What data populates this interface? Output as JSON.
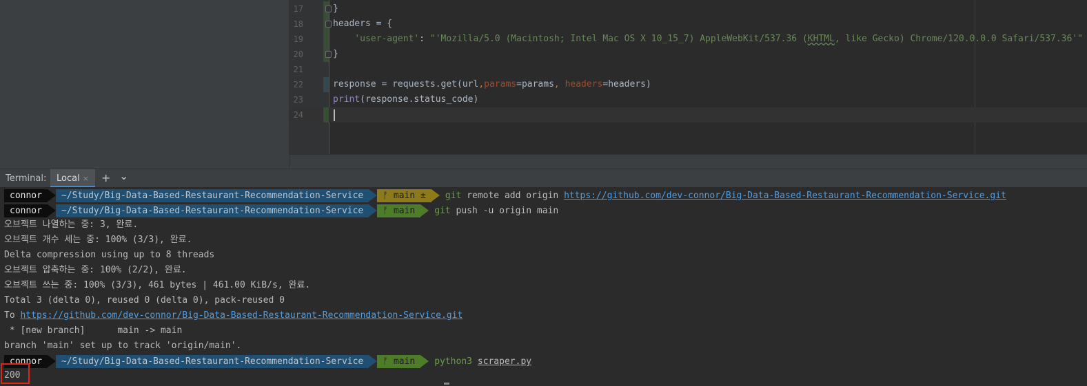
{
  "editor": {
    "lines": [
      {
        "num": "17",
        "tokens": [
          {
            "t": "}",
            "c": "plain"
          }
        ],
        "fold": true
      },
      {
        "num": "18",
        "tokens": [
          {
            "t": "headers = {",
            "c": "plain"
          }
        ],
        "fold": true
      },
      {
        "num": "19",
        "tokens": [
          {
            "t": "    ",
            "c": "plain"
          },
          {
            "t": "'user-agent'",
            "c": "str"
          },
          {
            "t": ": ",
            "c": "plain"
          },
          {
            "t": "\"'Mozilla/5.0 (Macintosh; Intel Mac OS X 10_15_7) AppleWebKit/537.36 (",
            "c": "str"
          },
          {
            "t": "KHTML",
            "c": "str-squiggle"
          },
          {
            "t": ", like Gecko) Chrome/120.0.0.0 Safari/537.36'\"",
            "c": "str"
          }
        ]
      },
      {
        "num": "20",
        "tokens": [
          {
            "t": "}",
            "c": "plain"
          }
        ],
        "fold": true
      },
      {
        "num": "21",
        "tokens": []
      },
      {
        "num": "22",
        "tokens": [
          {
            "t": "response = requests.get(url",
            "c": "plain"
          },
          {
            "t": ",",
            "c": "op"
          },
          {
            "t": "params",
            "c": "kwarg"
          },
          {
            "t": "=params",
            "c": "plain"
          },
          {
            "t": ", ",
            "c": "op"
          },
          {
            "t": "headers",
            "c": "kwarg"
          },
          {
            "t": "=headers)",
            "c": "plain"
          }
        ]
      },
      {
        "num": "23",
        "tokens": [
          {
            "t": "print",
            "c": "builtin"
          },
          {
            "t": "(response.status_code)",
            "c": "plain"
          }
        ]
      },
      {
        "num": "24",
        "tokens": [],
        "current": true
      }
    ]
  },
  "terminal": {
    "title": "Terminal:",
    "tab_label": "Local",
    "tab_close": "×",
    "add_button": "+",
    "dropdown": "⌄",
    "prompts": [
      {
        "user": "connor",
        "dir": "~/Study/Big-Data-Based-Restaurant-Recommendation-Service",
        "branch": "ᚠ main ±",
        "state": "dirty",
        "cmd": "git remote add origin ",
        "cmd_link": "https://github.com/dev-connor/Big-Data-Based-Restaurant-Recommendation-Service.git"
      },
      {
        "user": "connor",
        "dir": "~/Study/Big-Data-Based-Restaurant-Recommendation-Service",
        "branch": "ᚠ main",
        "state": "clean",
        "cmd": "git push -u origin main",
        "cmd_link": ""
      },
      {
        "user": "connor",
        "dir": "~/Study/Big-Data-Based-Restaurant-Recommendation-Service",
        "branch": "ᚠ main",
        "state": "clean",
        "cmd": "python3 ",
        "cmd_underlined": "scraper.py"
      }
    ],
    "output_lines": [
      "오브젝트 나열하는 중: 3, 완료.",
      "오브젝트 개수 세는 중: 100% (3/3), 완료.",
      "Delta compression using up to 8 threads",
      "오브젝트 압축하는 중: 100% (2/2), 완료.",
      "오브젝트 쓰는 중: 100% (3/3), 461 bytes | 461.00 KiB/s, 완료.",
      "Total 3 (delta 0), reused 0 (delta 0), pack-reused 0"
    ],
    "to_prefix": "To ",
    "to_link": "https://github.com/dev-connor/Big-Data-Based-Restaurant-Recommendation-Service.git",
    "branch_line": " * [new branch]      main -> main",
    "tracking_line": "branch 'main' set up to track 'origin/main'.",
    "result": "200"
  },
  "colors": {
    "highlight": "#e0261a",
    "link": "#4f9ee3",
    "prompt_dir_bg": "#1f4f72",
    "git_dirty_bg": "#8c7a1b",
    "git_clean_bg": "#4e7d2a"
  }
}
